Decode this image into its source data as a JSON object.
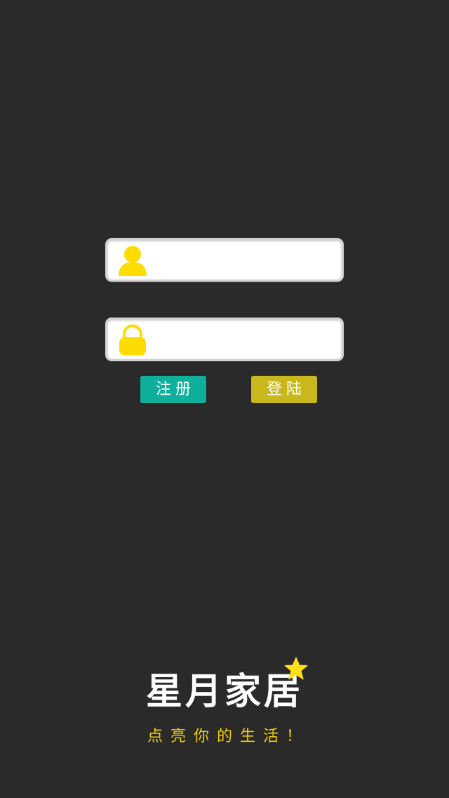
{
  "login_form": {
    "username": {
      "value": "",
      "placeholder": ""
    },
    "password": {
      "value": "",
      "placeholder": ""
    }
  },
  "buttons": {
    "register_label": "注册",
    "login_label": "登陆"
  },
  "brand": {
    "title": "星月家居",
    "tagline": "点亮你的生活！"
  },
  "icons": {
    "username": "user-icon",
    "password": "lock-icon",
    "brand": "star-icon"
  },
  "colors": {
    "background": "#2b2a2a",
    "icon_yellow": "#ffdc00",
    "register_button": "#0fb09b",
    "login_button": "#c8b81e",
    "tagline": "#f0d000"
  }
}
